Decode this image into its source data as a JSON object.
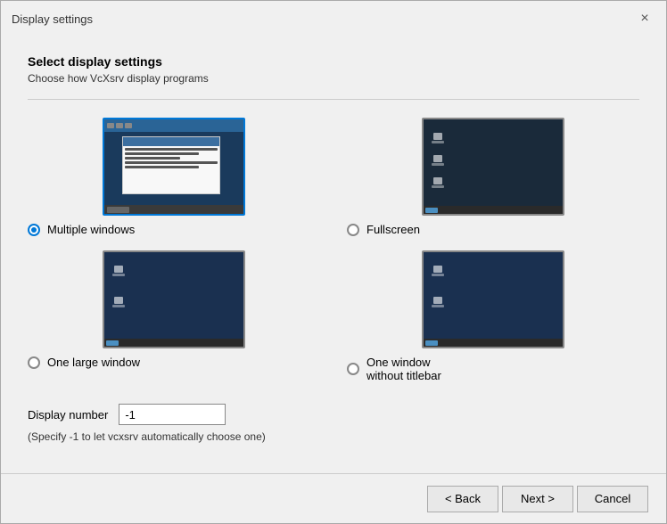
{
  "window": {
    "title": "Display settings",
    "close_label": "×"
  },
  "header": {
    "title": "Select display settings",
    "subtitle": "Choose how VcXsrv display programs"
  },
  "options": [
    {
      "id": "multiple-windows",
      "label": "Multiple windows",
      "checked": true,
      "position": "top-left"
    },
    {
      "id": "fullscreen",
      "label": "Fullscreen",
      "checked": false,
      "position": "top-right"
    },
    {
      "id": "one-large-window",
      "label": "One large window",
      "checked": false,
      "position": "bottom-left"
    },
    {
      "id": "one-window-without-titlebar",
      "label": "One window\nwithout titlebar",
      "checked": false,
      "position": "bottom-right"
    }
  ],
  "display_number": {
    "label": "Display number",
    "value": "-1",
    "placeholder": "-1"
  },
  "hint": "(Specify -1 to let vcxsrv automatically choose one)",
  "buttons": {
    "back": "< Back",
    "next": "Next >",
    "cancel": "Cancel"
  }
}
